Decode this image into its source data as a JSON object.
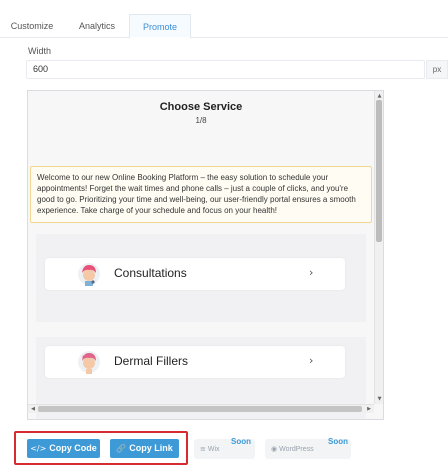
{
  "tabs": [
    {
      "label": "Customize"
    },
    {
      "label": "Analytics"
    },
    {
      "label": "Promote",
      "active": true
    }
  ],
  "width_field": {
    "label": "Width",
    "value": "600",
    "unit": "px"
  },
  "preview": {
    "title": "Choose Service",
    "step": "1/8",
    "notice": "Welcome to our new Online Booking Platform – the easy solution to schedule your appointments! Forget the wait times and phone calls – just a couple of clicks, and you're good to go. Prioritizing your time and well-being, our user-friendly portal ensures a smooth experience. Take charge of your schedule and focus on your health!",
    "services": [
      {
        "name": "Consultations",
        "icon": "doctor-avatar-icon"
      },
      {
        "name": "Dermal Fillers",
        "icon": "patient-avatar-icon"
      }
    ]
  },
  "actions": {
    "copy_code": "Copy Code",
    "copy_link": "Copy Link",
    "wix": "Wix",
    "wordpress": "WordPress",
    "soon": "Soon"
  },
  "colors": {
    "accent": "#3d9ad6",
    "highlight": "#d62b30",
    "notice_border": "#f1d792"
  }
}
